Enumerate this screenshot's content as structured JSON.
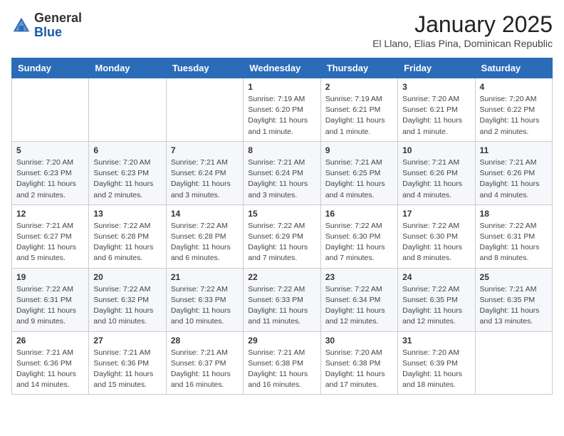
{
  "header": {
    "logo_general": "General",
    "logo_blue": "Blue",
    "title": "January 2025",
    "subtitle": "El Llano, Elias Pina, Dominican Republic"
  },
  "weekdays": [
    "Sunday",
    "Monday",
    "Tuesday",
    "Wednesday",
    "Thursday",
    "Friday",
    "Saturday"
  ],
  "weeks": [
    [
      {
        "day": "",
        "info": ""
      },
      {
        "day": "",
        "info": ""
      },
      {
        "day": "",
        "info": ""
      },
      {
        "day": "1",
        "info": "Sunrise: 7:19 AM\nSunset: 6:20 PM\nDaylight: 11 hours and 1 minute."
      },
      {
        "day": "2",
        "info": "Sunrise: 7:19 AM\nSunset: 6:21 PM\nDaylight: 11 hours and 1 minute."
      },
      {
        "day": "3",
        "info": "Sunrise: 7:20 AM\nSunset: 6:21 PM\nDaylight: 11 hours and 1 minute."
      },
      {
        "day": "4",
        "info": "Sunrise: 7:20 AM\nSunset: 6:22 PM\nDaylight: 11 hours and 2 minutes."
      }
    ],
    [
      {
        "day": "5",
        "info": "Sunrise: 7:20 AM\nSunset: 6:23 PM\nDaylight: 11 hours and 2 minutes."
      },
      {
        "day": "6",
        "info": "Sunrise: 7:20 AM\nSunset: 6:23 PM\nDaylight: 11 hours and 2 minutes."
      },
      {
        "day": "7",
        "info": "Sunrise: 7:21 AM\nSunset: 6:24 PM\nDaylight: 11 hours and 3 minutes."
      },
      {
        "day": "8",
        "info": "Sunrise: 7:21 AM\nSunset: 6:24 PM\nDaylight: 11 hours and 3 minutes."
      },
      {
        "day": "9",
        "info": "Sunrise: 7:21 AM\nSunset: 6:25 PM\nDaylight: 11 hours and 4 minutes."
      },
      {
        "day": "10",
        "info": "Sunrise: 7:21 AM\nSunset: 6:26 PM\nDaylight: 11 hours and 4 minutes."
      },
      {
        "day": "11",
        "info": "Sunrise: 7:21 AM\nSunset: 6:26 PM\nDaylight: 11 hours and 4 minutes."
      }
    ],
    [
      {
        "day": "12",
        "info": "Sunrise: 7:21 AM\nSunset: 6:27 PM\nDaylight: 11 hours and 5 minutes."
      },
      {
        "day": "13",
        "info": "Sunrise: 7:22 AM\nSunset: 6:28 PM\nDaylight: 11 hours and 6 minutes."
      },
      {
        "day": "14",
        "info": "Sunrise: 7:22 AM\nSunset: 6:28 PM\nDaylight: 11 hours and 6 minutes."
      },
      {
        "day": "15",
        "info": "Sunrise: 7:22 AM\nSunset: 6:29 PM\nDaylight: 11 hours and 7 minutes."
      },
      {
        "day": "16",
        "info": "Sunrise: 7:22 AM\nSunset: 6:30 PM\nDaylight: 11 hours and 7 minutes."
      },
      {
        "day": "17",
        "info": "Sunrise: 7:22 AM\nSunset: 6:30 PM\nDaylight: 11 hours and 8 minutes."
      },
      {
        "day": "18",
        "info": "Sunrise: 7:22 AM\nSunset: 6:31 PM\nDaylight: 11 hours and 8 minutes."
      }
    ],
    [
      {
        "day": "19",
        "info": "Sunrise: 7:22 AM\nSunset: 6:31 PM\nDaylight: 11 hours and 9 minutes."
      },
      {
        "day": "20",
        "info": "Sunrise: 7:22 AM\nSunset: 6:32 PM\nDaylight: 11 hours and 10 minutes."
      },
      {
        "day": "21",
        "info": "Sunrise: 7:22 AM\nSunset: 6:33 PM\nDaylight: 11 hours and 10 minutes."
      },
      {
        "day": "22",
        "info": "Sunrise: 7:22 AM\nSunset: 6:33 PM\nDaylight: 11 hours and 11 minutes."
      },
      {
        "day": "23",
        "info": "Sunrise: 7:22 AM\nSunset: 6:34 PM\nDaylight: 11 hours and 12 minutes."
      },
      {
        "day": "24",
        "info": "Sunrise: 7:22 AM\nSunset: 6:35 PM\nDaylight: 11 hours and 12 minutes."
      },
      {
        "day": "25",
        "info": "Sunrise: 7:21 AM\nSunset: 6:35 PM\nDaylight: 11 hours and 13 minutes."
      }
    ],
    [
      {
        "day": "26",
        "info": "Sunrise: 7:21 AM\nSunset: 6:36 PM\nDaylight: 11 hours and 14 minutes."
      },
      {
        "day": "27",
        "info": "Sunrise: 7:21 AM\nSunset: 6:36 PM\nDaylight: 11 hours and 15 minutes."
      },
      {
        "day": "28",
        "info": "Sunrise: 7:21 AM\nSunset: 6:37 PM\nDaylight: 11 hours and 16 minutes."
      },
      {
        "day": "29",
        "info": "Sunrise: 7:21 AM\nSunset: 6:38 PM\nDaylight: 11 hours and 16 minutes."
      },
      {
        "day": "30",
        "info": "Sunrise: 7:20 AM\nSunset: 6:38 PM\nDaylight: 11 hours and 17 minutes."
      },
      {
        "day": "31",
        "info": "Sunrise: 7:20 AM\nSunset: 6:39 PM\nDaylight: 11 hours and 18 minutes."
      },
      {
        "day": "",
        "info": ""
      }
    ]
  ]
}
